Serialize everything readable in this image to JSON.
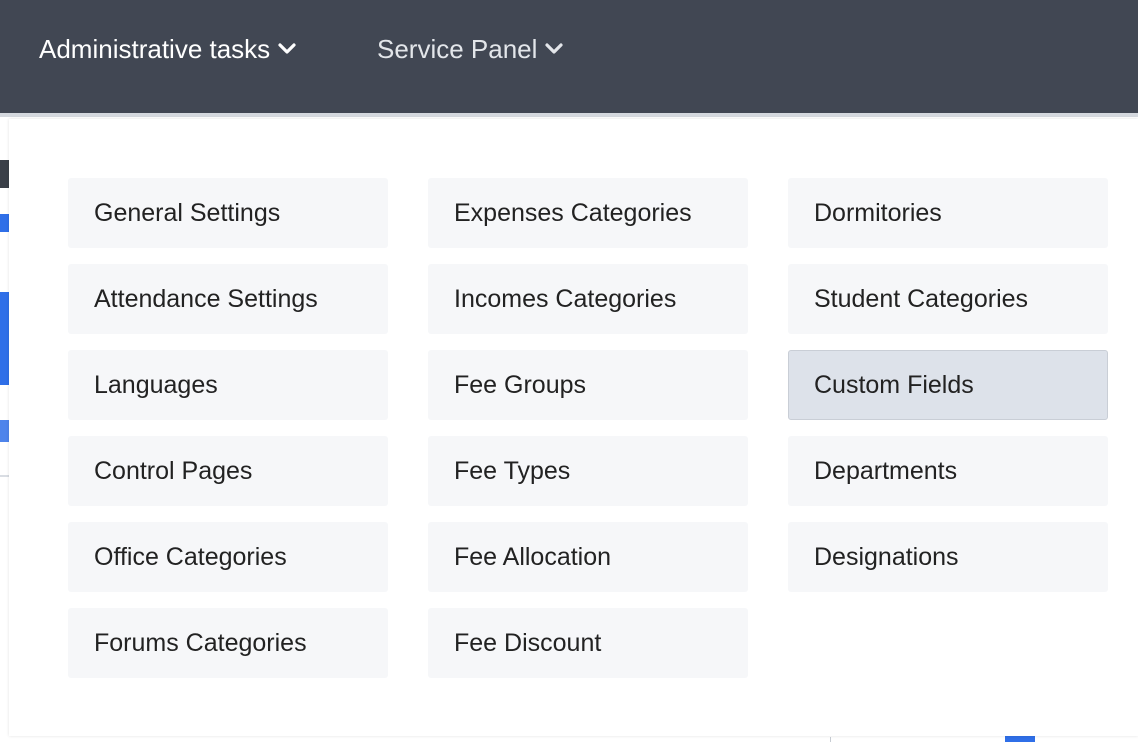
{
  "navbar": {
    "admin_label": "Administrative tasks",
    "service_label": "Service Panel",
    "background": "#414753"
  },
  "dropdown": {
    "columns": [
      [
        "General Settings",
        "Attendance Settings",
        "Languages",
        "Control Pages",
        "Office Categories",
        "Forums Categories"
      ],
      [
        "Expenses Categories",
        "Incomes Categories",
        "Fee Groups",
        "Fee Types",
        "Fee Allocation",
        "Fee Discount"
      ],
      [
        "Dormitories",
        "Student Categories",
        "Custom Fields",
        "Departments",
        "Designations"
      ]
    ],
    "active_item": "Custom Fields"
  },
  "colors": {
    "accent": "#2f6fe8",
    "item_bg": "#f6f7f9",
    "item_active_bg": "#dde2ea"
  }
}
